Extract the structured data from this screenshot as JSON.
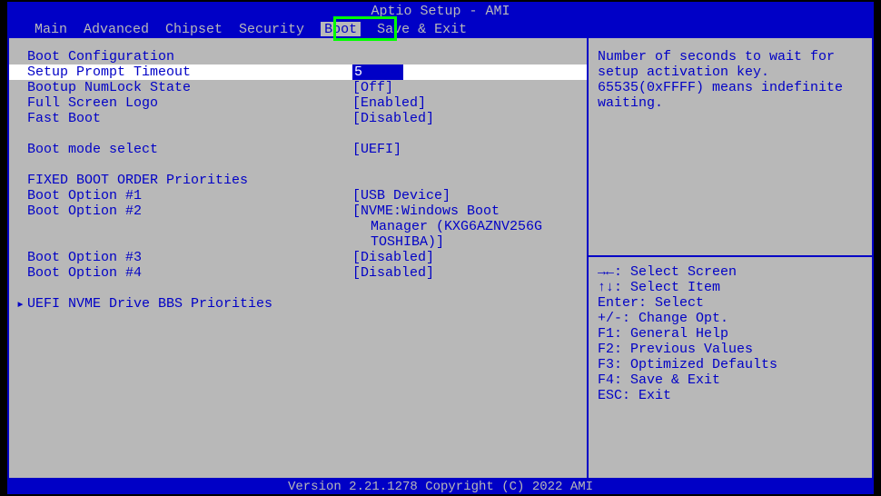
{
  "title": "Aptio Setup - AMI",
  "menu": {
    "items": [
      "Main",
      "Advanced",
      "Chipset",
      "Security",
      "Boot",
      "Save & Exit"
    ],
    "active_index": 4
  },
  "sections": {
    "boot_config_header": "Boot Configuration",
    "setup_prompt_timeout": {
      "label": "Setup Prompt Timeout",
      "value": "5"
    },
    "bootup_numlock": {
      "label": "Bootup NumLock State",
      "value": "[Off]"
    },
    "full_screen_logo": {
      "label": "Full Screen Logo",
      "value": "[Enabled]"
    },
    "fast_boot": {
      "label": "Fast Boot",
      "value": "[Disabled]"
    },
    "boot_mode_select": {
      "label": "Boot mode select",
      "value": "[UEFI]"
    },
    "fixed_boot_header": "FIXED BOOT ORDER Priorities",
    "boot_option_1": {
      "label": "Boot Option #1",
      "value": "[USB Device]"
    },
    "boot_option_2": {
      "label": "Boot Option #2",
      "value_line1": "[NVME:Windows Boot",
      "value_line2": "Manager (KXG6AZNV256G",
      "value_line3": "TOSHIBA)]"
    },
    "boot_option_3": {
      "label": "Boot Option #3",
      "value": "[Disabled]"
    },
    "boot_option_4": {
      "label": "Boot Option #4",
      "value": "[Disabled]"
    },
    "uefi_nvme_submenu": "UEFI NVME Drive BBS Priorities"
  },
  "help": {
    "line1": "Number of seconds to wait for",
    "line2": "setup activation key.",
    "line3": "65535(0xFFFF) means indefinite",
    "line4": "waiting."
  },
  "keys": {
    "k1": "→←: Select Screen",
    "k2": "↑↓: Select Item",
    "k3": "Enter: Select",
    "k4": "+/-: Change Opt.",
    "k5": "F1: General Help",
    "k6": "F2: Previous Values",
    "k7": "F3: Optimized Defaults",
    "k8": "F4: Save & Exit",
    "k9": "ESC: Exit"
  },
  "footer": "Version 2.21.1278 Copyright (C) 2022 AMI"
}
